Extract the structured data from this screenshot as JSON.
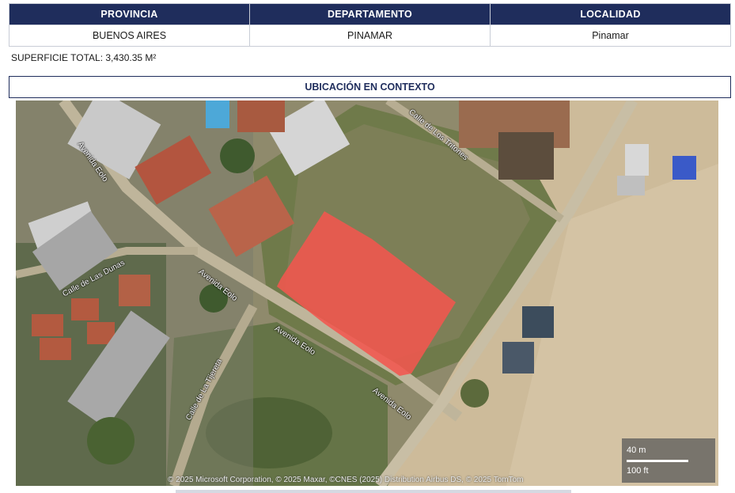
{
  "location_table": {
    "headers": [
      "PROVINCIA",
      "DEPARTAMENTO",
      "LOCALIDAD"
    ],
    "values": [
      "BUENOS AIRES",
      "PINAMAR",
      "Pinamar"
    ]
  },
  "surface_text": "SUPERFICIE TOTAL: 3,430.35 M²",
  "context_title": "UBICACIÓN EN CONTEXTO",
  "map": {
    "streets": {
      "avenida_eolo": "Avenida Eolo",
      "calle_tritones": "Calle de Los Tritones",
      "calle_dunas": "Calle de Las Dunas",
      "calle_tijereta": "Calle de La Tijereta"
    },
    "attribution": "© 2025 Microsoft Corporation, © 2025 Maxar, ©CNES (2025) Distribution Airbus DS, © 2025 TomTom",
    "scale_metric": "40 m",
    "scale_imperial": "100 ft",
    "parcel_color": "#f2574f"
  }
}
